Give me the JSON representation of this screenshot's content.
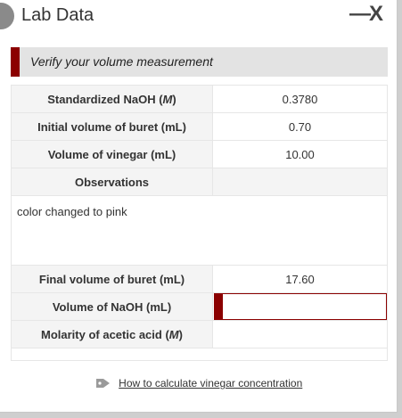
{
  "window": {
    "title": "Lab Data",
    "minimize_label": "—",
    "close_label": "X"
  },
  "banner": {
    "text": "Verify your volume measurement",
    "accent_color": "#8b0000"
  },
  "rows": [
    {
      "label": "Standardized NaOH (",
      "unit": "M",
      "suffix": ")",
      "value": "0.3780"
    },
    {
      "label": "Initial volume of buret (mL)",
      "value": "0.70"
    },
    {
      "label": "Volume of vinegar (mL)",
      "value": "10.00"
    }
  ],
  "observations": {
    "label": "Observations",
    "text": "color changed to pink"
  },
  "rows_after": [
    {
      "label": "Final volume of buret (mL)",
      "value": "17.60"
    }
  ],
  "naoh_volume": {
    "label": "Volume of NaOH (mL)",
    "value": ""
  },
  "molarity": {
    "label": "Molarity of acetic acid (",
    "unit": "M",
    "suffix": ")",
    "value": ""
  },
  "footer": {
    "icon": "tag-icon",
    "link_text": "How to calculate vinegar concentration"
  }
}
